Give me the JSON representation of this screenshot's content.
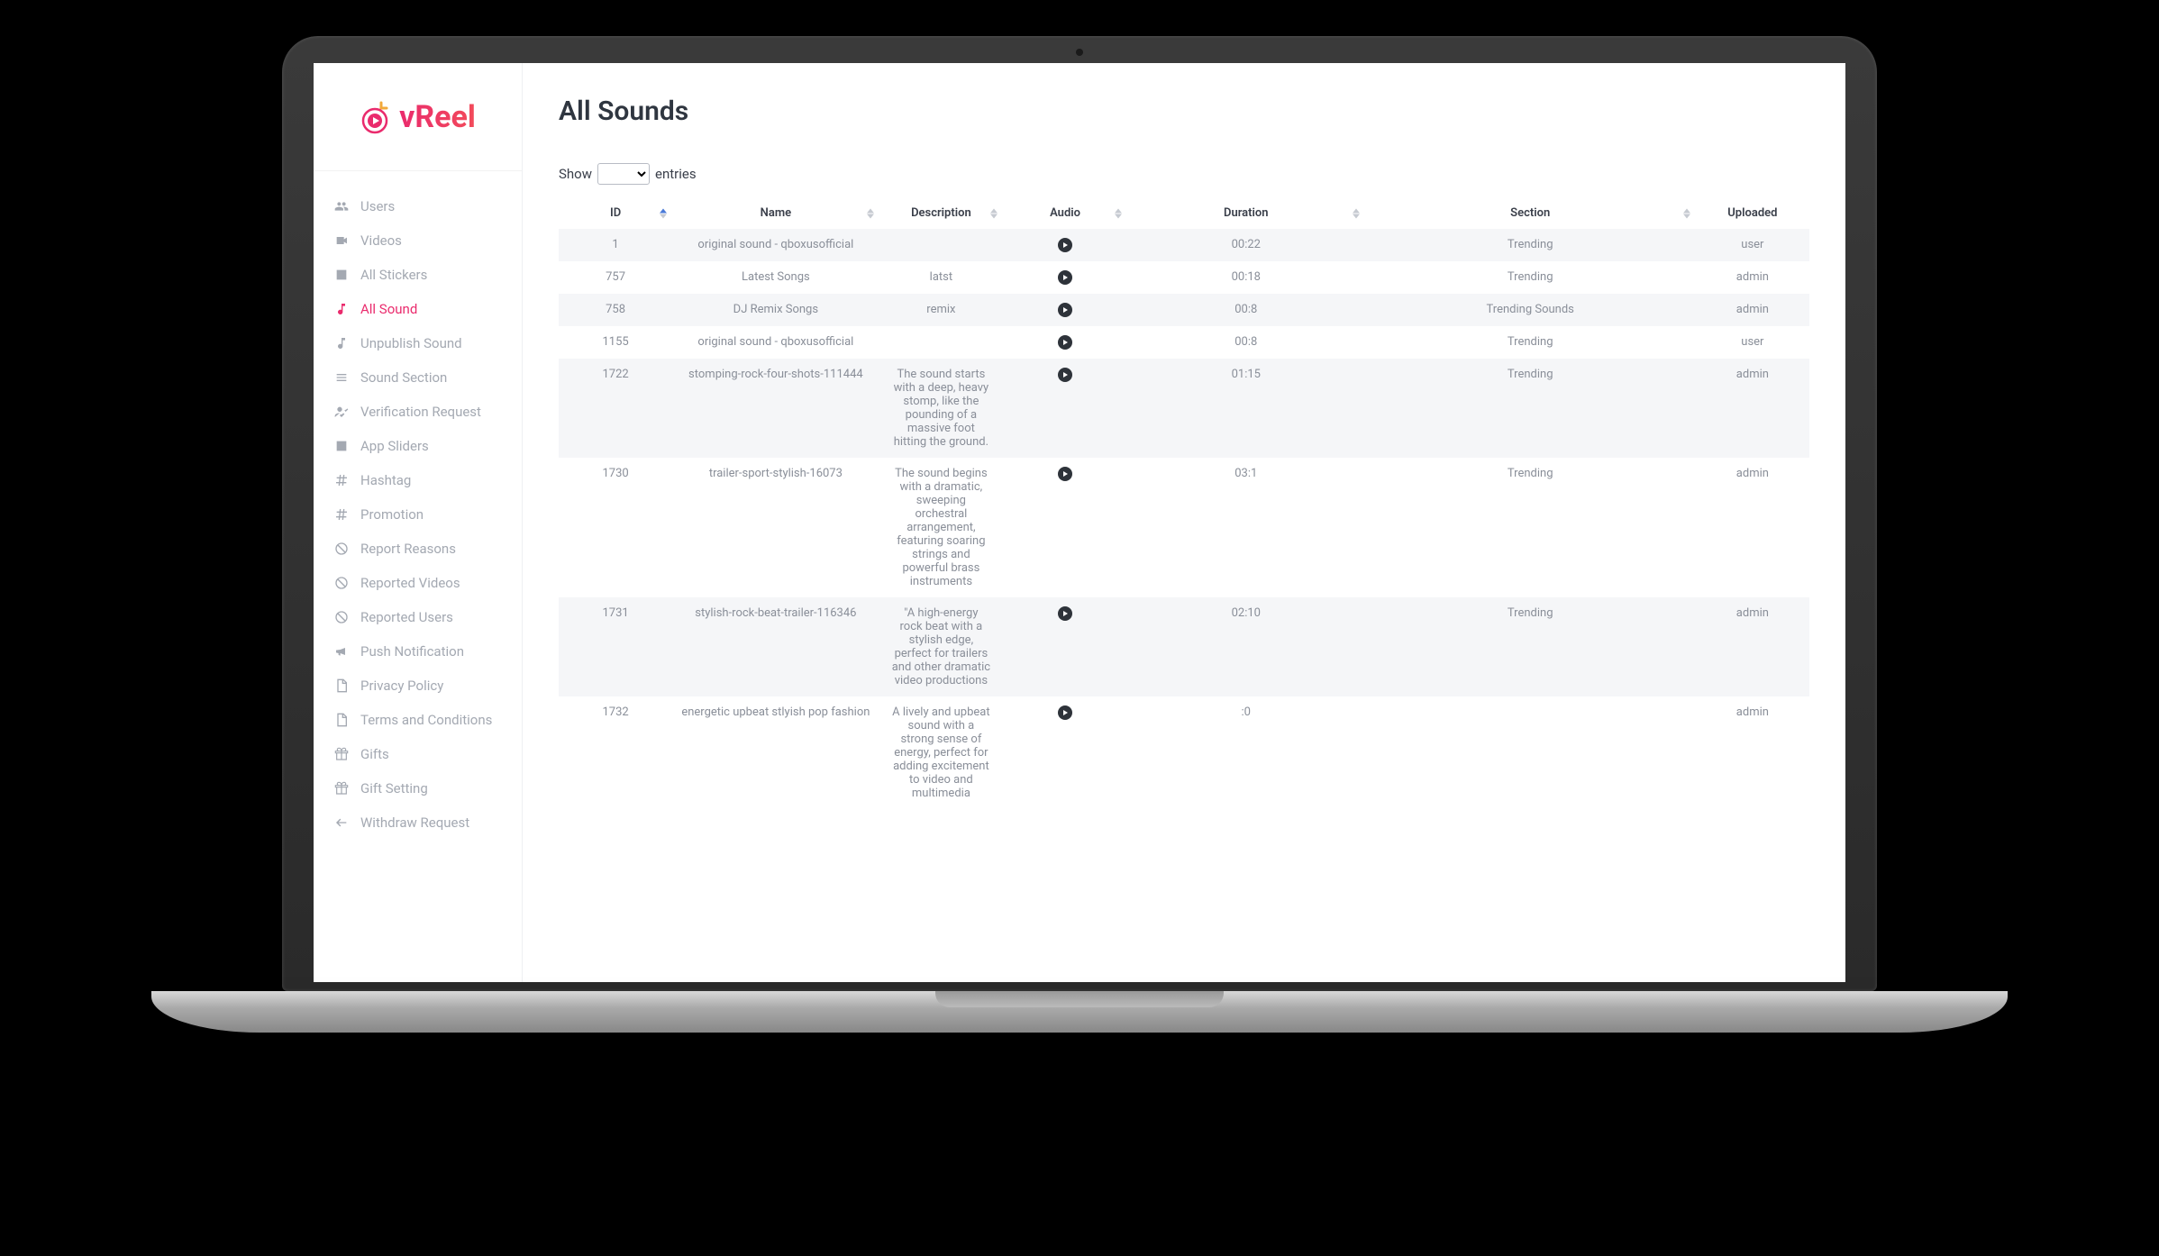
{
  "logo_text": "vReel",
  "page_title": "All Sounds",
  "entries": {
    "show_label": "Show",
    "entries_label": "entries"
  },
  "sidebar": {
    "items": [
      {
        "label": "Users",
        "icon": "users"
      },
      {
        "label": "Videos",
        "icon": "video"
      },
      {
        "label": "All Stickers",
        "icon": "image"
      },
      {
        "label": "All Sound",
        "icon": "music",
        "active": true
      },
      {
        "label": "Unpublish Sound",
        "icon": "music"
      },
      {
        "label": "Sound Section",
        "icon": "list"
      },
      {
        "label": "Verification Request",
        "icon": "user-check"
      },
      {
        "label": "App Sliders",
        "icon": "image"
      },
      {
        "label": "Hashtag",
        "icon": "hash"
      },
      {
        "label": "Promotion",
        "icon": "hash"
      },
      {
        "label": "Report Reasons",
        "icon": "ban"
      },
      {
        "label": "Reported Videos",
        "icon": "ban"
      },
      {
        "label": "Reported Users",
        "icon": "ban"
      },
      {
        "label": "Push Notification",
        "icon": "megaphone"
      },
      {
        "label": "Privacy Policy",
        "icon": "doc"
      },
      {
        "label": "Terms and Conditions",
        "icon": "doc"
      },
      {
        "label": "Gifts",
        "icon": "gift"
      },
      {
        "label": "Gift Setting",
        "icon": "gift"
      },
      {
        "label": "Withdraw Request",
        "icon": "arrow-left"
      }
    ]
  },
  "table": {
    "headers": {
      "id": "ID",
      "name": "Name",
      "description": "Description",
      "audio": "Audio",
      "duration": "Duration",
      "section": "Section",
      "uploaded": "Uploaded"
    },
    "rows": [
      {
        "id": "1",
        "name": "original sound - qboxusofficial",
        "description": "",
        "duration": "00:22",
        "section": "Trending",
        "uploaded": "user"
      },
      {
        "id": "757",
        "name": "Latest Songs",
        "description": "latst",
        "duration": "00:18",
        "section": "Trending",
        "uploaded": "admin"
      },
      {
        "id": "758",
        "name": "DJ Remix Songs",
        "description": "remix",
        "duration": "00:8",
        "section": "Trending Sounds",
        "uploaded": "admin"
      },
      {
        "id": "1155",
        "name": "original sound - qboxusofficial",
        "description": "",
        "duration": "00:8",
        "section": "Trending",
        "uploaded": "user"
      },
      {
        "id": "1722",
        "name": "stomping-rock-four-shots-111444",
        "description": "The sound starts with a deep, heavy stomp, like the pounding of a massive foot hitting the ground.",
        "duration": "01:15",
        "section": "Trending",
        "uploaded": "admin"
      },
      {
        "id": "1730",
        "name": "trailer-sport-stylish-16073",
        "description": "The sound begins with a dramatic, sweeping orchestral arrangement, featuring soaring strings and powerful brass instruments",
        "duration": "03:1",
        "section": "Trending",
        "uploaded": "admin"
      },
      {
        "id": "1731",
        "name": "stylish-rock-beat-trailer-116346",
        "description": "\"A high-energy rock beat with a stylish edge, perfect for trailers and other dramatic video productions",
        "duration": "02:10",
        "section": "Trending",
        "uploaded": "admin"
      },
      {
        "id": "1732",
        "name": "energetic upbeat stlyish pop fashion",
        "description": "A lively and upbeat sound with a strong sense of energy, perfect for adding excitement to video and multimedia",
        "duration": ":0",
        "section": "",
        "uploaded": "admin"
      }
    ]
  }
}
